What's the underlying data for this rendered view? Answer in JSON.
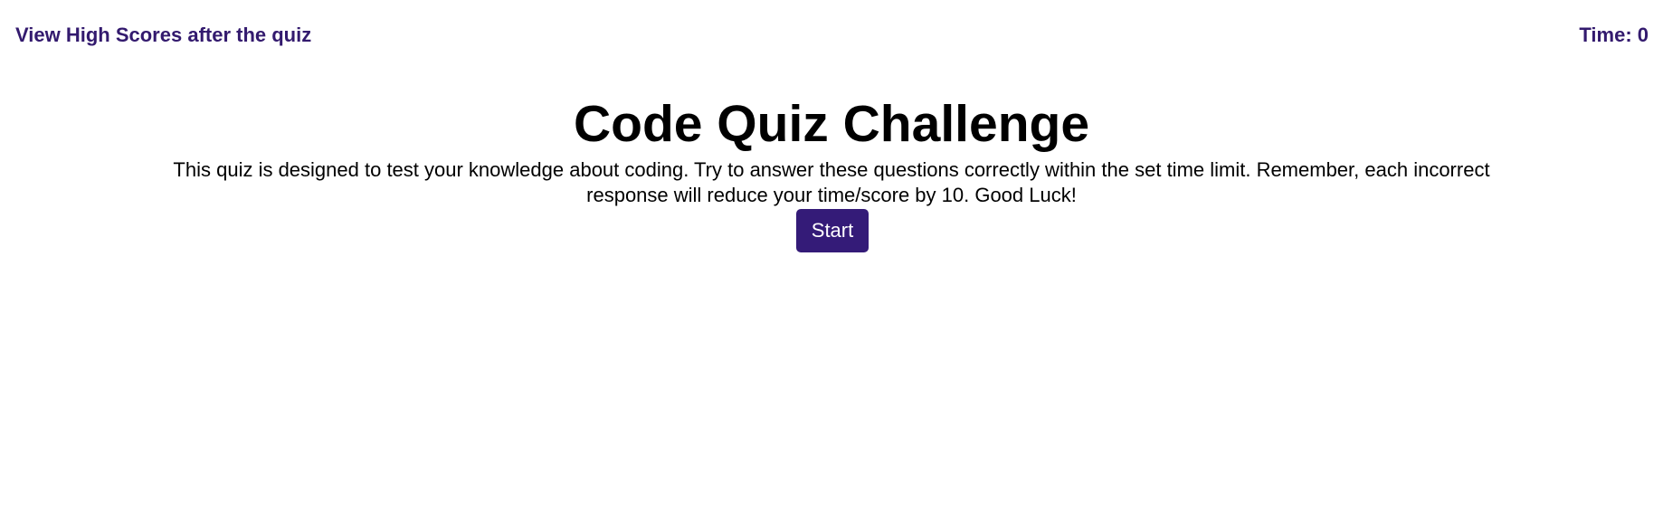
{
  "header": {
    "high_scores_link": "View High Scores after the quiz",
    "timer": "Time: 0"
  },
  "main": {
    "title": "Code Quiz Challenge",
    "description": "This quiz is designed to test your knowledge about coding. Try to answer these questions correctly within the set time limit. Remember, each incorrect response will reduce your time/score by 10. Good Luck!",
    "start_button": "Start"
  },
  "colors": {
    "accent": "#341b78"
  }
}
